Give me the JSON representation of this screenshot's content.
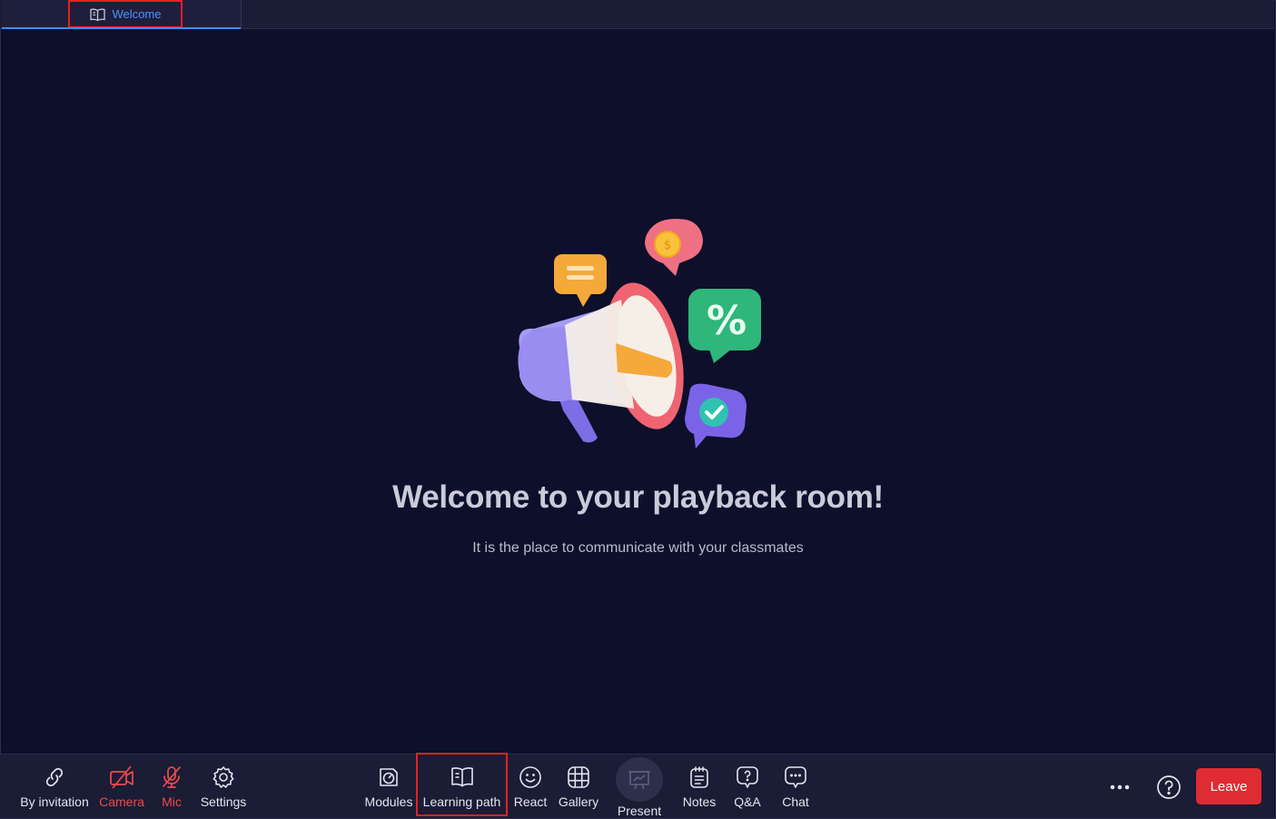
{
  "tab": {
    "label": "Welcome",
    "icon": "book-open-icon"
  },
  "main": {
    "headline": "Welcome to your playback room!",
    "subline": "It is the place to communicate with your classmates",
    "illustration": "megaphone-illustration"
  },
  "toolbar": {
    "left": [
      {
        "label": "By invitation",
        "icon": "link-icon"
      },
      {
        "label": "Camera",
        "icon": "camera-off-icon",
        "status": "off"
      },
      {
        "label": "Mic",
        "icon": "mic-off-icon",
        "status": "off"
      },
      {
        "label": "Settings",
        "icon": "gear-icon"
      }
    ],
    "center": [
      {
        "label": "Modules",
        "icon": "modules-icon"
      },
      {
        "label": "Learning path",
        "icon": "book-open-icon"
      },
      {
        "label": "React",
        "icon": "smiley-icon"
      },
      {
        "label": "Gallery",
        "icon": "grid-icon"
      },
      {
        "label": "Present",
        "icon": "present-icon"
      },
      {
        "label": "Notes",
        "icon": "notes-icon"
      },
      {
        "label": "Q&A",
        "icon": "question-bubble-icon"
      },
      {
        "label": "Chat",
        "icon": "chat-icon"
      }
    ],
    "leave_label": "Leave"
  },
  "colors": {
    "background": "#0e0f2b",
    "bar": "#1b1c35",
    "accent": "#3b8dff",
    "danger": "#e02b32",
    "highlight": "#e62121"
  }
}
